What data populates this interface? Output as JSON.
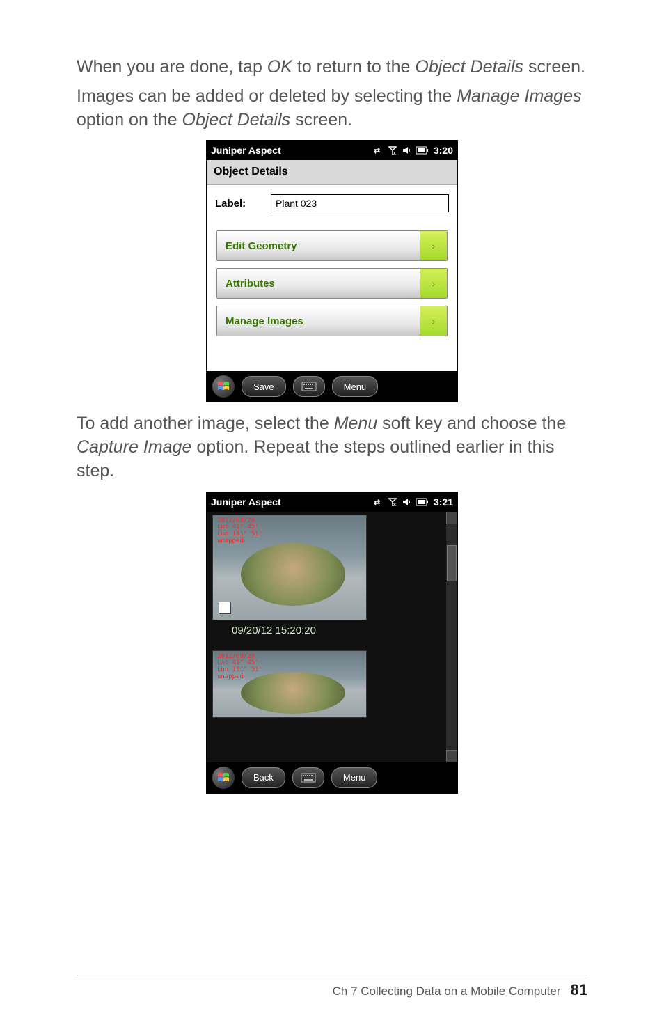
{
  "paragraphs": {
    "p1_a": "When you are done, tap ",
    "p1_ok": "OK",
    "p1_b": " to return to the ",
    "p1_od": "Object Details",
    "p1_c": " screen.",
    "p2_a": "Images can be added or deleted by selecting the ",
    "p2_mi": "Manage Images",
    "p2_b": " option on the ",
    "p2_od": "Object Details",
    "p2_c": " screen.",
    "p3_a": "To add another image, select the ",
    "p3_menu": "Menu",
    "p3_b": " soft key and choose the ",
    "p3_ci": "Capture Image",
    "p3_c": " option. Repeat the steps outlined earlier in this step."
  },
  "device1": {
    "title": "Juniper Aspect",
    "time": "3:20",
    "subheader": "Object Details",
    "label_caption": "Label:",
    "label_value": "Plant 023",
    "items": {
      "edit_geometry": "Edit Geometry",
      "attributes": "Attributes",
      "manage_images": "Manage Images"
    },
    "softkeys": {
      "left": "Save",
      "right": "Menu"
    }
  },
  "device2": {
    "title": "Juniper Aspect",
    "time": "3:21",
    "caption1": "09/20/12 15:20:20",
    "softkeys": {
      "left": "Back",
      "right": "Menu"
    }
  },
  "footer": {
    "chapter": "Ch 7   Collecting Data on a Mobile Computer",
    "page": "81"
  }
}
